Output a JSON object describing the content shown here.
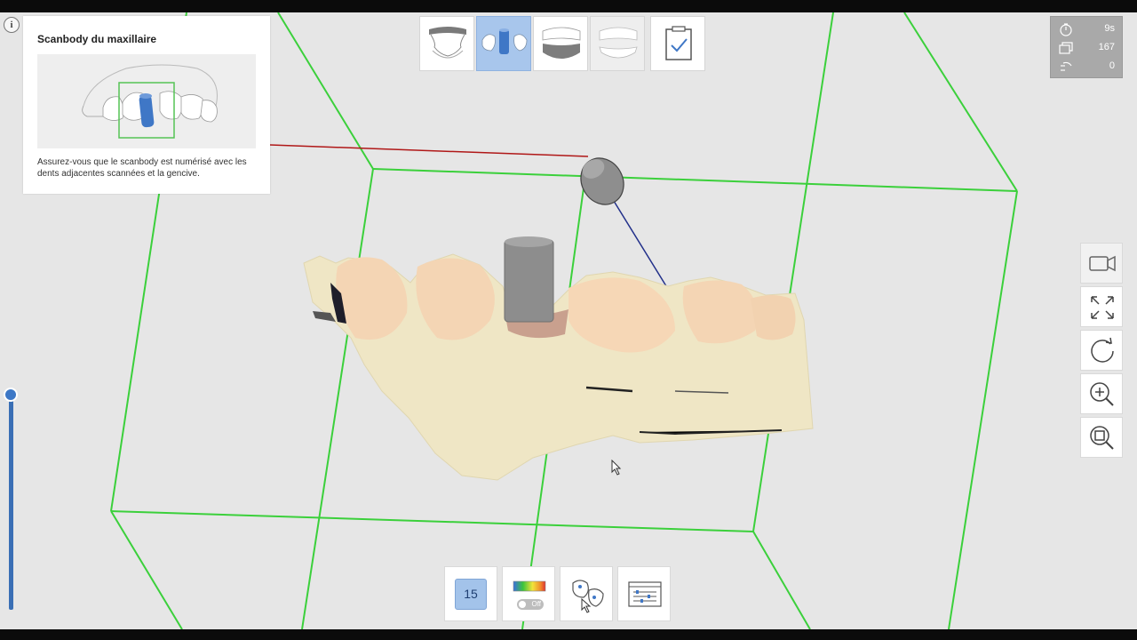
{
  "guide": {
    "title": "Scanbody du maxillaire",
    "instruction": "Assurez-vous que le scanbody est numérisé avec les dents adjacentes scannées et la gencive."
  },
  "stages": [
    {
      "name": "arcade-inferieure",
      "icon": "lower-jaw-icon",
      "active": false
    },
    {
      "name": "scanbody-maxillaire",
      "icon": "scanbody-jaw-icon",
      "active": true
    },
    {
      "name": "occlusion",
      "icon": "bite-icon",
      "active": false
    },
    {
      "name": "arcade-superieure",
      "icon": "upper-jaw-icon",
      "active": false
    },
    {
      "name": "validation",
      "icon": "clipboard-check-icon",
      "active": false
    }
  ],
  "stats": {
    "scan_time": "9s",
    "frame_count": "167",
    "third_value": "0"
  },
  "bottom_tools": {
    "shot_count": "15",
    "color_toggle_label": "Off"
  },
  "colors": {
    "accent_blue": "#a8c6ec",
    "bounding_box_green": "#2ecc2e",
    "slider_blue": "#3a6fb5"
  }
}
